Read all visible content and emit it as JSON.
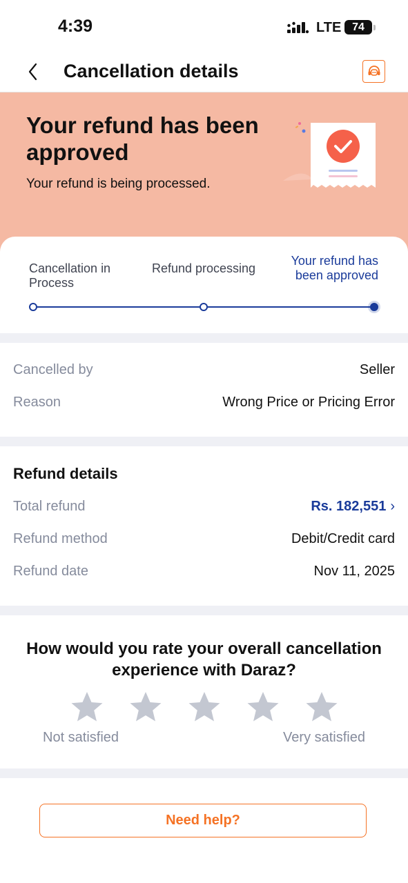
{
  "status_bar": {
    "time": "4:39",
    "network": "LTE",
    "battery": "74"
  },
  "header": {
    "title": "Cancellation details",
    "back_icon": "chevron-left-icon",
    "support_icon": "customer-service-icon"
  },
  "hero": {
    "title": "Your refund has been approved",
    "subtitle": "Your refund is being processed.",
    "illustration_icon": "receipt-check-icon"
  },
  "progress": {
    "steps": [
      {
        "label": "Cancellation in Process",
        "done": true
      },
      {
        "label": "Refund processing",
        "done": true
      },
      {
        "label": "Your refund has been approved",
        "current": true
      }
    ],
    "accent_color": "#1a3b9a"
  },
  "cancellation": {
    "rows": [
      {
        "label": "Cancelled by",
        "value": "Seller"
      },
      {
        "label": "Reason",
        "value": "Wrong Price or Pricing Error"
      }
    ]
  },
  "refund_details": {
    "title": "Refund details",
    "total_label": "Total refund",
    "total_value": "Rs. 182,551",
    "method_label": "Refund method",
    "method_value": "Debit/Credit card",
    "date_label": "Refund date",
    "date_value": "Nov 11, 2025"
  },
  "rating": {
    "question": "How would you rate your overall cancellation experience with Daraz?",
    "stars": 5,
    "selected": 0,
    "low_label": "Not satisfied",
    "high_label": "Very satisfied"
  },
  "help": {
    "label": "Need help?"
  },
  "colors": {
    "brand": "#f57224",
    "hero_bg": "#f5b9a3",
    "link": "#1a3b9a"
  }
}
